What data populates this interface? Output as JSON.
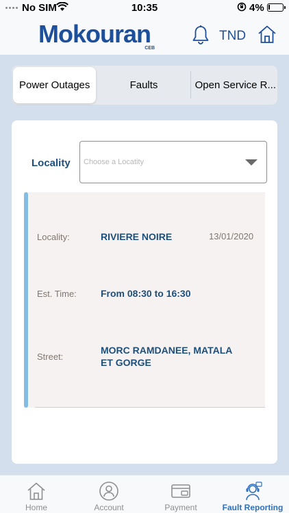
{
  "status_bar": {
    "carrier": "No SIM",
    "time": "10:35",
    "battery": "4%"
  },
  "header": {
    "logo_text": "Mokouran",
    "logo_sub": "CEB",
    "currency": "TND",
    "icons": [
      "bell-icon",
      "home-icon"
    ]
  },
  "tabs": [
    {
      "label": "Power Outages",
      "active": true
    },
    {
      "label": "Faults",
      "active": false
    },
    {
      "label": "Open Service R...",
      "active": false
    }
  ],
  "filter": {
    "label": "Locality",
    "placeholder": "Choose a Locatity"
  },
  "outage": {
    "locality_label": "Locality:",
    "locality_value": "RIVIERE NOIRE",
    "date": "13/01/2020",
    "time_label": "Est. Time:",
    "time_value": "From 08:30 to 16:30",
    "street_label": "Street:",
    "street_value_line1": "MORC RAMDANEE, MATALA",
    "street_value_line2": "ET GORGE"
  },
  "bottom_nav": [
    {
      "label": "Home",
      "icon": "home-icon",
      "active": false
    },
    {
      "label": "Account",
      "icon": "account-icon",
      "active": false
    },
    {
      "label": "Payment",
      "icon": "payment-icon",
      "active": false
    },
    {
      "label": "Fault Reporting",
      "icon": "fault-reporting-icon",
      "active": true
    }
  ],
  "colors": {
    "brand_blue": "#1d4f9a",
    "accent_bar": "#84bde4",
    "active_nav": "#2e6fbf",
    "page_bg": "#d3dfec"
  }
}
